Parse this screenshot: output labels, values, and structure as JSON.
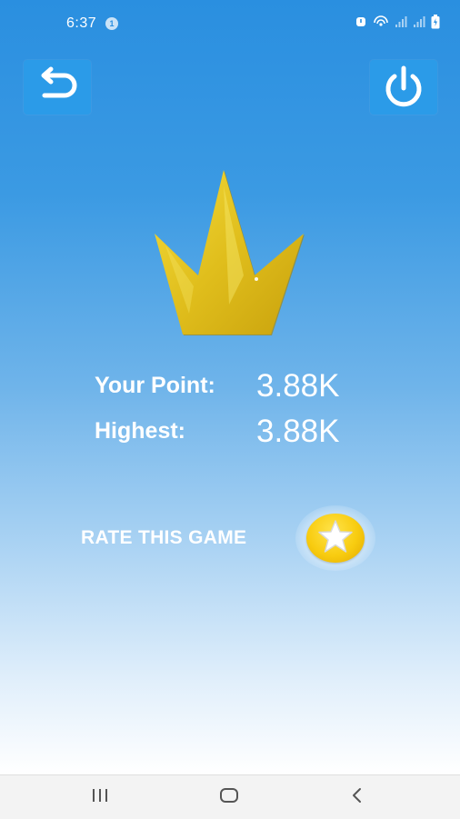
{
  "status_bar": {
    "time": "6:37",
    "notification_count": "1",
    "icons": [
      "alarm-icon",
      "hotspot-icon",
      "signal-icon",
      "signal-icon",
      "battery-icon"
    ]
  },
  "toolbar": {
    "restart_icon": "restart-icon",
    "power_icon": "power-icon"
  },
  "score": {
    "point_label": "Your Point:",
    "point_value": "3.88K",
    "highest_label": "Highest:",
    "highest_value": "3.88K"
  },
  "rate": {
    "label": "RATE THIS GAME",
    "icon": "star-icon"
  },
  "nav_bar": {
    "recents_icon": "recents-icon",
    "home_icon": "home-icon",
    "back_icon": "back-icon"
  },
  "colors": {
    "background_top": "#2a8fe0",
    "background_bottom": "#ffffff",
    "button_bg": "#2b9be8",
    "crown_gold": "#e3c21a",
    "coin_gold": "#f8cc10"
  }
}
